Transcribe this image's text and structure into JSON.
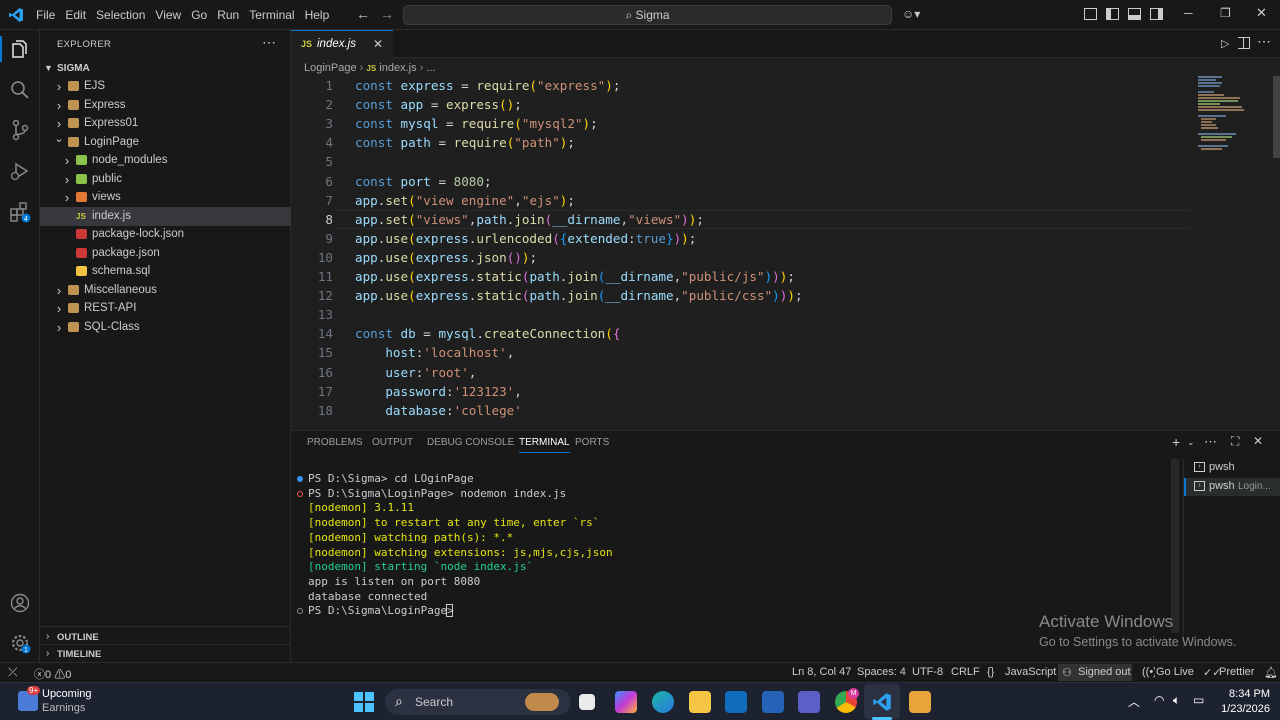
{
  "menu": [
    "File",
    "Edit",
    "Selection",
    "View",
    "Go",
    "Run",
    "Terminal",
    "Help"
  ],
  "search": {
    "text": "Sigma"
  },
  "explorer": {
    "title": "EXPLORER",
    "root": "SIGMA",
    "items": [
      {
        "label": "EJS",
        "type": "folder",
        "indent": 1,
        "open": false
      },
      {
        "label": "Express",
        "type": "folder",
        "indent": 1,
        "open": false
      },
      {
        "label": "Express01",
        "type": "folder",
        "indent": 1,
        "open": false
      },
      {
        "label": "LoginPage",
        "type": "folder",
        "indent": 1,
        "open": true
      },
      {
        "label": "node_modules",
        "type": "folder-green",
        "indent": 2,
        "open": false
      },
      {
        "label": "public",
        "type": "folder-green",
        "indent": 2,
        "open": false
      },
      {
        "label": "views",
        "type": "folder-red",
        "indent": 2,
        "open": false
      },
      {
        "label": "index.js",
        "type": "js",
        "indent": 2,
        "selected": true
      },
      {
        "label": "package-lock.json",
        "type": "npm",
        "indent": 2
      },
      {
        "label": "package.json",
        "type": "npm",
        "indent": 2
      },
      {
        "label": "schema.sql",
        "type": "sql",
        "indent": 2
      },
      {
        "label": "Miscellaneous",
        "type": "folder",
        "indent": 1,
        "open": false
      },
      {
        "label": "REST-API",
        "type": "folder",
        "indent": 1,
        "open": false
      },
      {
        "label": "SQL-Class",
        "type": "folder",
        "indent": 1,
        "open": false
      }
    ],
    "outline": "OUTLINE",
    "timeline": "TIMELINE"
  },
  "tab": {
    "label": "index.js",
    "icon": "JS"
  },
  "breadcrumb": {
    "folder": "LoginPage",
    "file": "index.js",
    "more": "..."
  },
  "code_lines": [
    "<span class=\"k\">const</span> <span class=\"v\">express</span> = <span class=\"f\">require</span><span class=\"p\">(</span><span class=\"s\">\"express\"</span><span class=\"p\">)</span>;",
    "<span class=\"k\">const</span> <span class=\"v\">app</span> = <span class=\"f\">express</span><span class=\"p\">()</span>;",
    "<span class=\"k\">const</span> <span class=\"v\">mysql</span> = <span class=\"f\">require</span><span class=\"p\">(</span><span class=\"s\">\"mysql2\"</span><span class=\"p\">)</span>;",
    "<span class=\"k\">const</span> <span class=\"v\">path</span> = <span class=\"f\">require</span><span class=\"p\">(</span><span class=\"s\">\"path\"</span><span class=\"p\">)</span>;",
    "",
    "<span class=\"k\">const</span> <span class=\"v\">port</span> = <span class=\"n\">8080</span>;",
    "<span class=\"v\">app</span>.<span class=\"f\">set</span><span class=\"p\">(</span><span class=\"s\">\"view engine\"</span>,<span class=\"s\">\"ejs\"</span><span class=\"p\">)</span>;",
    "<span class=\"v\">app</span>.<span class=\"f\">set</span><span class=\"p\">(</span><span class=\"s\">\"views\"</span>,<span class=\"v\">path</span>.<span class=\"f\">join</span><span class=\"p2\">(</span><span class=\"v\">__dirname</span>,<span class=\"s\">\"views\"</span><span class=\"p2\">)</span><span class=\"p\">)</span>;",
    "<span class=\"v\">app</span>.<span class=\"f\">use</span><span class=\"p\">(</span><span class=\"v\">express</span>.<span class=\"f\">urlencoded</span><span class=\"p2\">(</span><span class=\"p3\">{</span><span class=\"v\">extended</span>:<span class=\"k\">true</span><span class=\"p3\">}</span><span class=\"p2\">)</span><span class=\"p\">)</span>;",
    "<span class=\"v\">app</span>.<span class=\"f\">use</span><span class=\"p\">(</span><span class=\"v\">express</span>.<span class=\"f\">json</span><span class=\"p2\">()</span><span class=\"p\">)</span>;",
    "<span class=\"v\">app</span>.<span class=\"f\">use</span><span class=\"p\">(</span><span class=\"v\">express</span>.<span class=\"f\">static</span><span class=\"p2\">(</span><span class=\"v\">path</span>.<span class=\"f\">join</span><span class=\"p3\">(</span><span class=\"v\">__dirname</span>,<span class=\"s\">\"public/js\"</span><span class=\"p3\">)</span><span class=\"p2\">)</span><span class=\"p\">)</span>;",
    "<span class=\"v\">app</span>.<span class=\"f\">use</span><span class=\"p\">(</span><span class=\"v\">express</span>.<span class=\"f\">static</span><span class=\"p2\">(</span><span class=\"v\">path</span>.<span class=\"f\">join</span><span class=\"p3\">(</span><span class=\"v\">__dirname</span>,<span class=\"s\">\"public/css\"</span><span class=\"p3\">)</span><span class=\"p2\">)</span><span class=\"p\">)</span>;",
    "",
    "<span class=\"k\">const</span> <span class=\"v\">db</span> = <span class=\"v\">mysql</span>.<span class=\"f\">createConnection</span><span class=\"p\">(</span><span class=\"p2\">{</span>",
    "    <span class=\"v\">host</span>:<span class=\"s\">'localhost'</span>,",
    "    <span class=\"v\">user</span>:<span class=\"s\">'root'</span>,",
    "    <span class=\"v\">password</span>:<span class=\"s\">'123123'</span>,",
    "    <span class=\"v\">database</span>:<span class=\"s\">'college'</span>"
  ],
  "panel": {
    "tabs": [
      "PROBLEMS",
      "OUTPUT",
      "DEBUG CONSOLE",
      "TERMINAL",
      "PORTS"
    ],
    "active_tab": "TERMINAL",
    "terminal_lines": [
      {
        "text": "PS D:\\Sigma> cd LOginPage",
        "cls": "",
        "dot": "blue"
      },
      {
        "text": "PS D:\\Sigma\\LoginPage> nodemon index.js",
        "cls": "",
        "dot": "red"
      },
      {
        "text": "[nodemon] 3.1.11",
        "cls": "yellow",
        "dot": ""
      },
      {
        "text": "[nodemon] to restart at any time, enter `rs`",
        "cls": "yellow",
        "dot": ""
      },
      {
        "text": "[nodemon] watching path(s): *.*",
        "cls": "yellow",
        "dot": ""
      },
      {
        "text": "[nodemon] watching extensions: js,mjs,cjs,json",
        "cls": "yellow",
        "dot": ""
      },
      {
        "text": "[nodemon] starting `node index.js`",
        "cls": "green",
        "dot": ""
      },
      {
        "text": "app is listen on port 8080",
        "cls": "",
        "dot": ""
      },
      {
        "text": "database connected",
        "cls": "",
        "dot": ""
      },
      {
        "text": "PS D:\\Sigma\\LoginPage> ",
        "cls": "",
        "dot": "gray"
      }
    ],
    "terminals": [
      {
        "label": "pwsh",
        "sub": ""
      },
      {
        "label": "pwsh",
        "sub": "Login..."
      }
    ]
  },
  "watermark": {
    "title": "Activate Windows",
    "sub": "Go to Settings to activate Windows."
  },
  "status": {
    "errors": "0",
    "warnings": "0",
    "position": "Ln 8, Col 47",
    "spaces": "Spaces: 4",
    "encoding": "UTF-8",
    "eol": "CRLF",
    "language": "JavaScript",
    "signed": "Signed out",
    "golive": "Go Live",
    "prettier": "Prettier"
  },
  "taskbar": {
    "weather_title": "Upcoming",
    "weather_sub": "Earnings",
    "badge": "9+",
    "search": "Search",
    "time": "8:34 PM",
    "date": "1/23/2026"
  },
  "colors": {
    "accent": "#0078d4",
    "bg": "#1f1f1f",
    "sidebar": "#181818"
  }
}
